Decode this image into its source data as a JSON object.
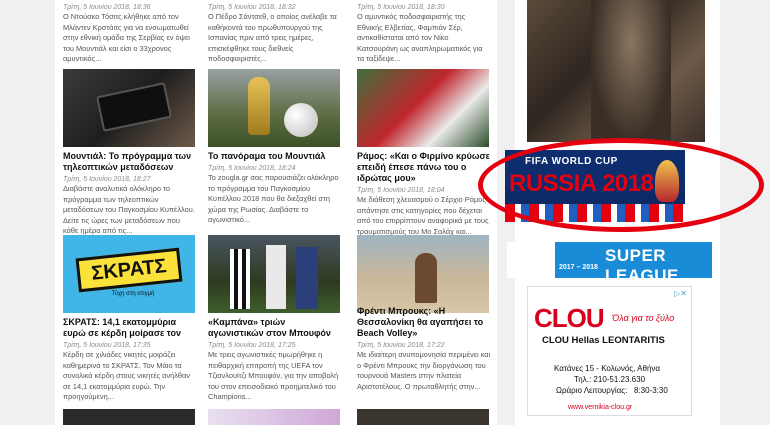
{
  "articles": [
    {
      "date": "Τρίτη, 5 Ιουνίου 2018, 18:36",
      "excerpt": "Ο Ντούσκο Τόσιτς κλήθηκε από τον Μλάντεν Κρστάιτς για να ενσωματωθεί στην εθνική ομάδα της Σερβίας εν όψει του Μουντιάλ και είσι ο 33χρονος αμυντικός..."
    },
    {
      "date": "Τρίτη, 5 Ιουνίου 2018, 18:32",
      "excerpt": "Ο Πέδρο Σάντσεθ, ο οποίος ανέλαβε τα καθήκοντά του πρωθυπουργού της Ισπανίας πριν από τρεις ημέρες, επισκέφθηκε τους διεθνείς ποδοσφαιριστές..."
    },
    {
      "date": "Τρίτη, 5 Ιουνίου 2018, 18:30",
      "excerpt": "Ο αμυντικός ποδοσφαιριστής της Εθνικής Ελβετίας, Φαμπιάν Σέρ, αντικαθίσταται από τον Νίκο Κατσουράνη ως αναπληρωματικός για τα ταξίδεψε..."
    },
    {
      "title": "Μουντιάλ: Το πρόγραμμα των τηλεοπτικών μεταδόσεων",
      "date": "Τρίτη, 5 Ιουνίου 2018, 18:27",
      "excerpt": "Διαβάστε αναλυτικά ολόκληρο το πρόγραμμα των τηλεοπτικών μεταδόσεων του Παγκοσμίου Κυπέλλου. Δείτε τις ώρες των μεταδόσεων που κάθε ημέρα από τις..."
    },
    {
      "title": "Το πανόραμα του Μουντιάλ 2018",
      "date": "Τρίτη, 5 Ιουνίου 2018, 18:24",
      "excerpt": "Το zougla.gr σας παρουσιάζει ολόκληρο το πρόγραμμα του Παγκοσμίου Κυπέλλου 2018 που θα διεξαχθεί στη χώρα της Ρωσίας. Διαβάστε το αγωνιστικό..."
    },
    {
      "title": "Ράμος: «Και ο Φιρμίνο κρύωσε επειδή έπεσε πάνω του ο ιδρώτας μου»",
      "date": "Τρίτη, 5 Ιουνίου 2018, 18:04",
      "excerpt": "Με διάθεση χλευασμού ο Σέρχιο Ράμος απάντησε στις κατηγορίες που δέχεται από του επιρρίπτουν αναφορικά με τους τραυματισμούς του Μο Σαλάχ και..."
    },
    {
      "title": "ΣΚΡΑΤΣ: 14,1 εκατομμύρια ευρώ σε κέρδη μοίρασε τον Μάιο",
      "date": "Τρίτη, 5 Ιουνίου 2018, 17:35",
      "excerpt": "Κέρδη σε χιλιάδες νικητές μοιράζει καθημερινά το ΣΚΡΑΤΣ. Τον Μάιο τα συνολικά κέρδη στους νικητές ανήλθαν σε 14,1 εκατομμύρια ευρώ. Την προηγούμενη..."
    },
    {
      "title": "«Καμπάνα» τριών αγωνιστικών στον Μπουφόν",
      "date": "Τρίτη, 5 Ιουνίου 2018, 17:25",
      "excerpt": "Με τρεις αγωνιστικές τιμωρήθηκε η πειθαρχική επιτροπή της UEFA τον Τζιανλουίτζι Μπουφόν, για την αποβολή του στον επεισοδιακό προημιτελικό του Champions..."
    },
    {
      "title": "Φρέντι Μπρουκς: «Η Θεσσαλονίκη θα αγαπήσει το Beach Volley»",
      "date": "Τρίτη, 5 Ιουνίου 2018, 17:22",
      "excerpt": "Με ιδιαίτερη ανυπομονησία περιμένει και ο Φρέντι Μπρουκς την διοργάνωση του τουρνουά Masters στην πλατεία Αριστοτέλους. Ο πρωταθλητής στην..."
    }
  ],
  "thumb3_text": "ΣΚΡΑΤΣ",
  "thumb3_sub": "Τύχη στη στιγμή",
  "sidebar": {
    "fifa_line1": "FIFA WORLD CUP",
    "fifa_line2": "RUSSIA 2018",
    "super_year": "2017 – 2018",
    "super_text": "SUPER LEAGUE",
    "clou_brand": "CLOU",
    "clou_tagline": "Όλα για το ξύλο",
    "clou_name": "CLOU Hellas LEONTARITIS",
    "clou_address": "Κατάνες 15 - Κολωνός, Αθήνα",
    "clou_phone": "Τηλ.: 210-51.23.630",
    "clou_hours_label": "Ωράριο Λειτουργίας:",
    "clou_hours": "8:30-3:30",
    "clou_url": "www.vernikia-clou.gr"
  },
  "colors": {
    "highlight": "#e4000f",
    "brand_red": "#d6001c",
    "fifa_blue": "#0d2d6e"
  }
}
